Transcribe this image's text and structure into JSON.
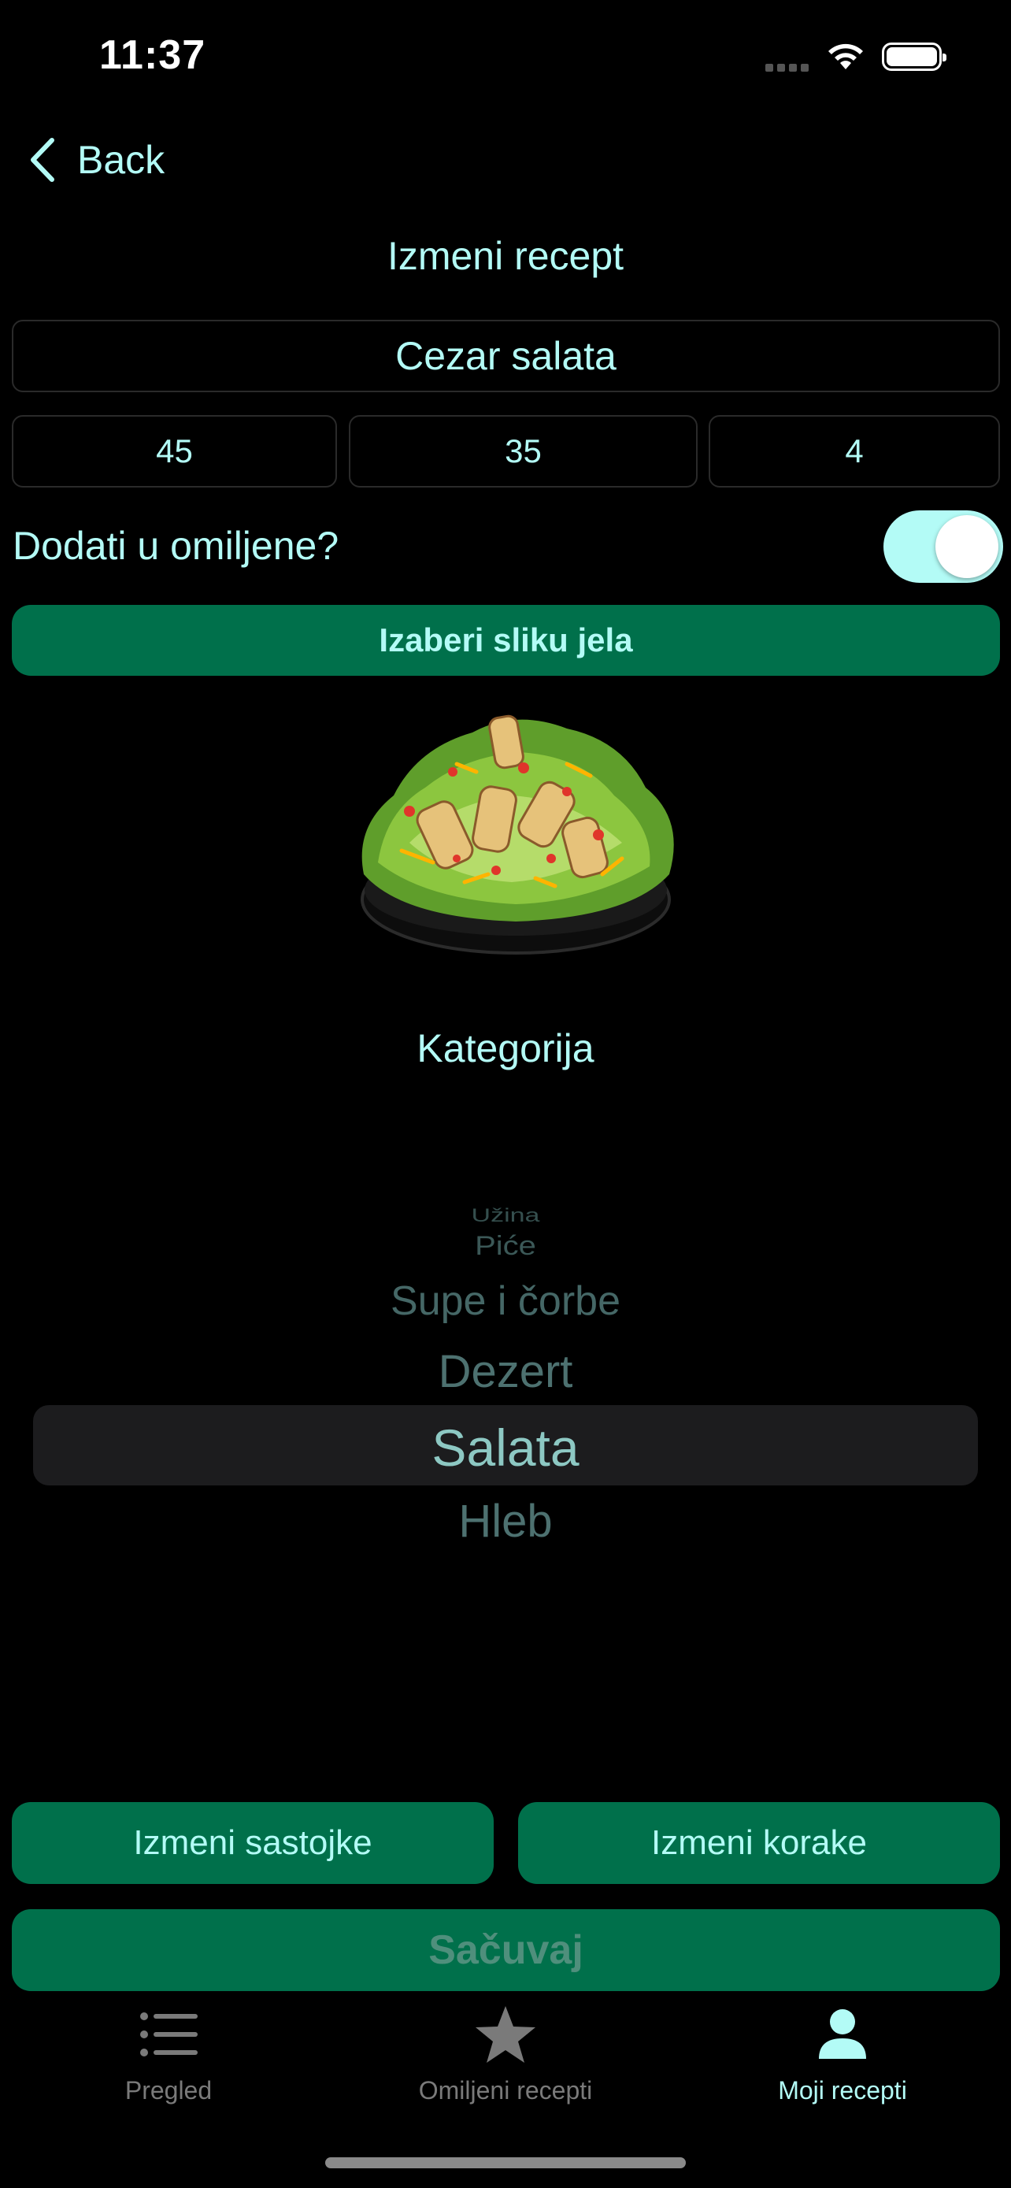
{
  "status_bar": {
    "time": "11:37"
  },
  "nav": {
    "back_label": "Back",
    "title": "Izmeni recept"
  },
  "form": {
    "recipe_name": "Cezar salata",
    "prep_time": "45",
    "cook_time": "35",
    "servings": "4",
    "favorite_label": "Dodati u omiljene?",
    "favorite_on": true,
    "pick_image_label": "Izaberi sliku jela"
  },
  "category": {
    "title": "Kategorija",
    "options": [
      "Užina",
      "Piće",
      "Supe i čorbe",
      "Dezert",
      "Salata",
      "Hleb"
    ],
    "selected": "Salata"
  },
  "actions": {
    "edit_ingredients": "Izmeni sastojke",
    "edit_steps": "Izmeni korake",
    "save": "Sačuvaj"
  },
  "tabbar": {
    "tabs": [
      {
        "label": "Pregled",
        "icon": "list-icon",
        "active": false
      },
      {
        "label": "Omiljeni recepti",
        "icon": "star-icon",
        "active": false
      },
      {
        "label": "Moji recepti",
        "icon": "person-icon",
        "active": true
      }
    ]
  },
  "colors": {
    "accent_text": "#b3fbf6",
    "button_green": "#00704b",
    "background": "#000000"
  }
}
